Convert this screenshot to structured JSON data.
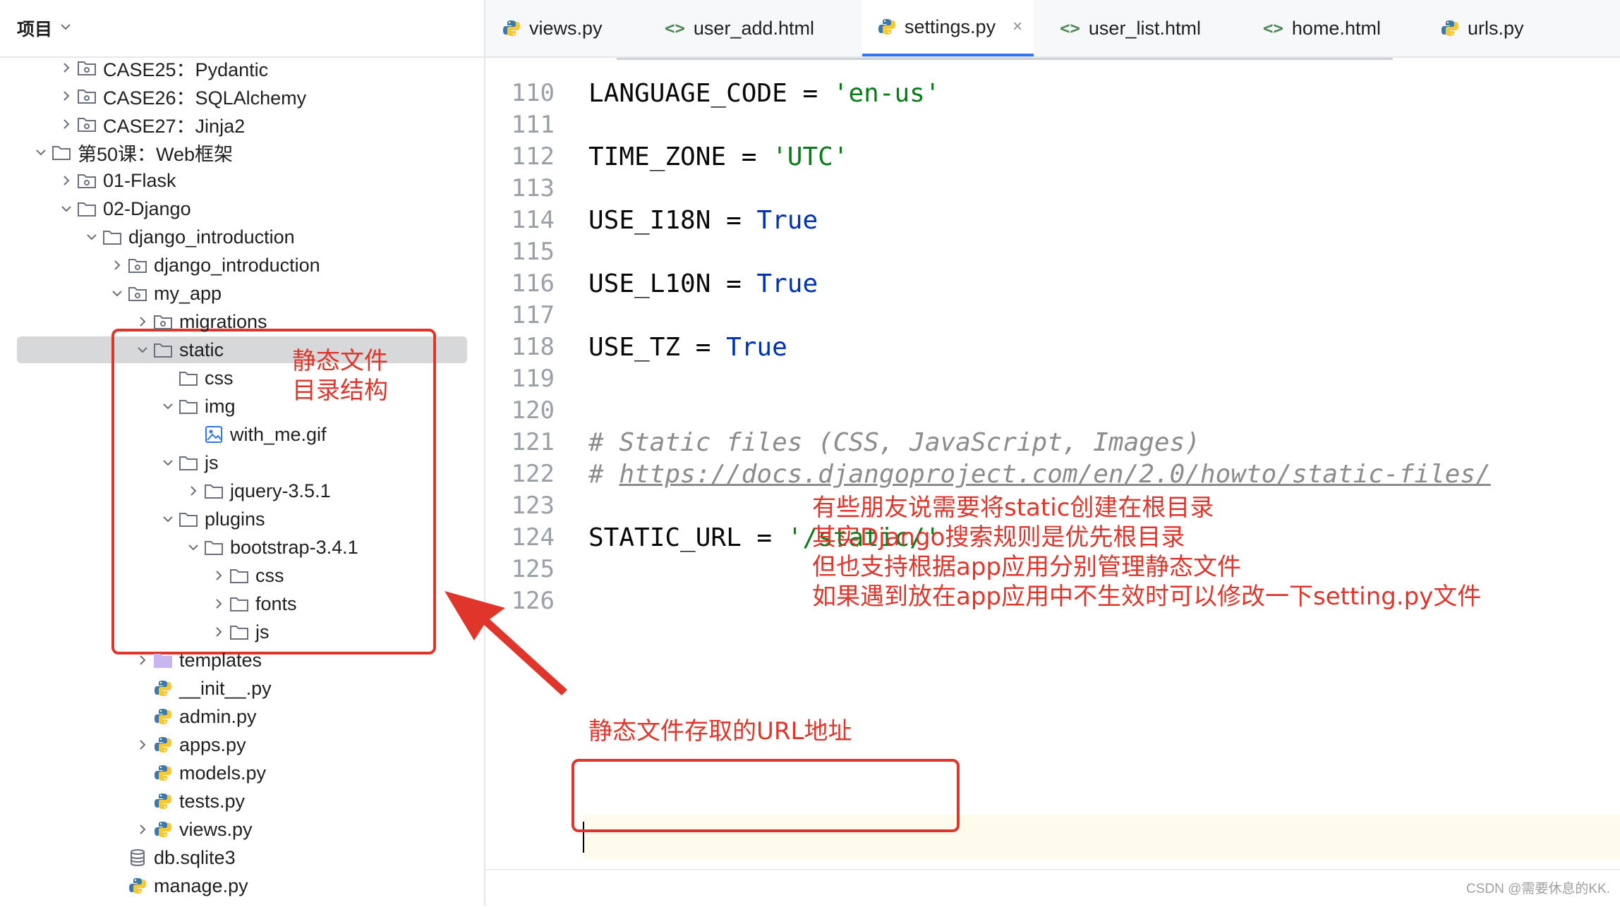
{
  "project": {
    "title": "项目",
    "tree": [
      {
        "label": "CASE25：Pydantic",
        "icon": "package-folder-icon",
        "arrow": "right",
        "depth": 0
      },
      {
        "label": "CASE26：SQLAlchemy",
        "icon": "package-folder-icon",
        "arrow": "right",
        "depth": 0
      },
      {
        "label": "CASE27：Jinja2",
        "icon": "package-folder-icon",
        "arrow": "right",
        "depth": 0
      },
      {
        "label": "第50课：Web框架",
        "icon": "folder-icon",
        "arrow": "down",
        "depth": -1
      },
      {
        "label": "01-Flask",
        "icon": "package-folder-icon",
        "arrow": "right",
        "depth": 0
      },
      {
        "label": "02-Django",
        "icon": "folder-icon",
        "arrow": "down",
        "depth": 0
      },
      {
        "label": "django_introduction",
        "icon": "folder-icon",
        "arrow": "down",
        "depth": 1
      },
      {
        "label": "django_introduction",
        "icon": "package-folder-icon",
        "arrow": "right",
        "depth": 2
      },
      {
        "label": "my_app",
        "icon": "package-folder-icon",
        "arrow": "down",
        "depth": 2
      },
      {
        "label": "migrations",
        "icon": "package-folder-icon",
        "arrow": "right",
        "depth": 3
      },
      {
        "label": "static",
        "icon": "folder-icon",
        "arrow": "down",
        "depth": 3,
        "selected": true
      },
      {
        "label": "css",
        "icon": "folder-icon",
        "arrow": "none",
        "depth": 4
      },
      {
        "label": "img",
        "icon": "folder-icon",
        "arrow": "down",
        "depth": 4
      },
      {
        "label": "with_me.gif",
        "icon": "image-file-icon",
        "arrow": "none",
        "depth": 5
      },
      {
        "label": "js",
        "icon": "folder-icon",
        "arrow": "down",
        "depth": 4
      },
      {
        "label": "jquery-3.5.1",
        "icon": "folder-icon",
        "arrow": "right",
        "depth": 5
      },
      {
        "label": "plugins",
        "icon": "folder-icon",
        "arrow": "down",
        "depth": 4
      },
      {
        "label": "bootstrap-3.4.1",
        "icon": "folder-icon",
        "arrow": "down",
        "depth": 5
      },
      {
        "label": "css",
        "icon": "folder-icon",
        "arrow": "right",
        "depth": 6
      },
      {
        "label": "fonts",
        "icon": "folder-icon",
        "arrow": "right",
        "depth": 6
      },
      {
        "label": "js",
        "icon": "folder-icon",
        "arrow": "right",
        "depth": 6
      },
      {
        "label": "templates",
        "icon": "templates-folder-icon",
        "arrow": "right",
        "depth": 3
      },
      {
        "label": "__init__.py",
        "icon": "python-file-icon",
        "arrow": "none",
        "depth": 3
      },
      {
        "label": "admin.py",
        "icon": "python-file-icon",
        "arrow": "none",
        "depth": 3
      },
      {
        "label": "apps.py",
        "icon": "python-file-icon",
        "arrow": "right",
        "depth": 3
      },
      {
        "label": "models.py",
        "icon": "python-file-icon",
        "arrow": "none",
        "depth": 3
      },
      {
        "label": "tests.py",
        "icon": "python-file-icon",
        "arrow": "none",
        "depth": 3
      },
      {
        "label": "views.py",
        "icon": "python-file-icon",
        "arrow": "right",
        "depth": 3
      },
      {
        "label": "db.sqlite3",
        "icon": "database-icon",
        "arrow": "none",
        "depth": 2
      },
      {
        "label": "manage.py",
        "icon": "python-file-icon",
        "arrow": "none",
        "depth": 2
      }
    ]
  },
  "tabs": [
    {
      "label": "views.py",
      "icon": "python-file-icon",
      "active": false
    },
    {
      "label": "user_add.html",
      "icon": "html-file-icon",
      "active": false
    },
    {
      "label": "settings.py",
      "icon": "python-file-icon",
      "active": true,
      "close": "×"
    },
    {
      "label": "user_list.html",
      "icon": "html-file-icon",
      "active": false
    },
    {
      "label": "home.html",
      "icon": "html-file-icon",
      "active": false
    },
    {
      "label": "urls.py",
      "icon": "python-file-icon",
      "active": false
    }
  ],
  "editor": {
    "line_numbers": [
      "110",
      "111",
      "112",
      "113",
      "114",
      "115",
      "116",
      "117",
      "118",
      "119",
      "120",
      "121",
      "122",
      "123",
      "124",
      "125",
      "126"
    ],
    "lines": {
      "l111": {
        "name": "LANGUAGE_CODE",
        "op": " = ",
        "value": "'en-us'"
      },
      "l113": {
        "name": "TIME_ZONE",
        "op": " = ",
        "value": "'UTC'"
      },
      "l115": {
        "name": "USE_I18N",
        "op": " = ",
        "value": "True"
      },
      "l117": {
        "name": "USE_L10N",
        "op": " = ",
        "value": "True"
      },
      "l119": {
        "name": "USE_TZ",
        "op": " = ",
        "value": "True"
      },
      "l122": {
        "comment": "# Static files (CSS, JavaScript, Images)"
      },
      "l123": {
        "hash": "# ",
        "url": "https://docs.djangoproject.com/en/2.0/howto/static-files/"
      },
      "l125": {
        "name": "STATIC_URL",
        "op": " = ",
        "value": "'/static/'"
      }
    }
  },
  "annotations": {
    "static_dir": "静态文件\n目录结构",
    "root_note": "有些朋友说需要将static创建在根目录\n其实Django搜索规则是优先根目录\n但也支持根据app应用分别管理静态文件\n如果遇到放在app应用中不生效时可以修改一下setting.py文件",
    "url_note": "静态文件存取的URL地址",
    "color": "#e0352b"
  },
  "watermark": "CSDN @需要休息的KK."
}
